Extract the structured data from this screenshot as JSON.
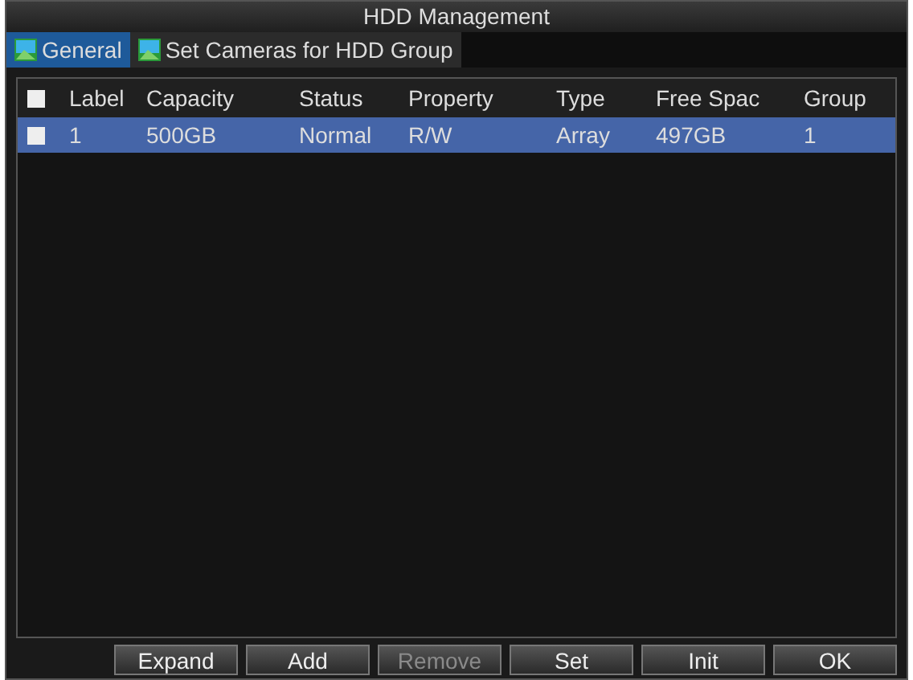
{
  "window": {
    "title": "HDD Management"
  },
  "tabs": [
    {
      "label": "General",
      "selected": true
    },
    {
      "label": "Set Cameras for HDD Group",
      "selected": false
    }
  ],
  "table": {
    "select_all_checked": false,
    "columns": [
      "Label",
      "Capacity",
      "Status",
      "Property",
      "Type",
      "Free Spac",
      "Group"
    ],
    "rows": [
      {
        "checked": false,
        "selected": true,
        "cells": [
          "1",
          "500GB",
          "Normal",
          "R/W",
          "Array",
          "497GB",
          "1"
        ]
      }
    ]
  },
  "buttons": [
    {
      "label": "Expand",
      "disabled": false
    },
    {
      "label": "Add",
      "disabled": false
    },
    {
      "label": "Remove",
      "disabled": true
    },
    {
      "label": "Set",
      "disabled": false
    },
    {
      "label": "Init",
      "disabled": false
    },
    {
      "label": "OK",
      "disabled": false
    }
  ]
}
